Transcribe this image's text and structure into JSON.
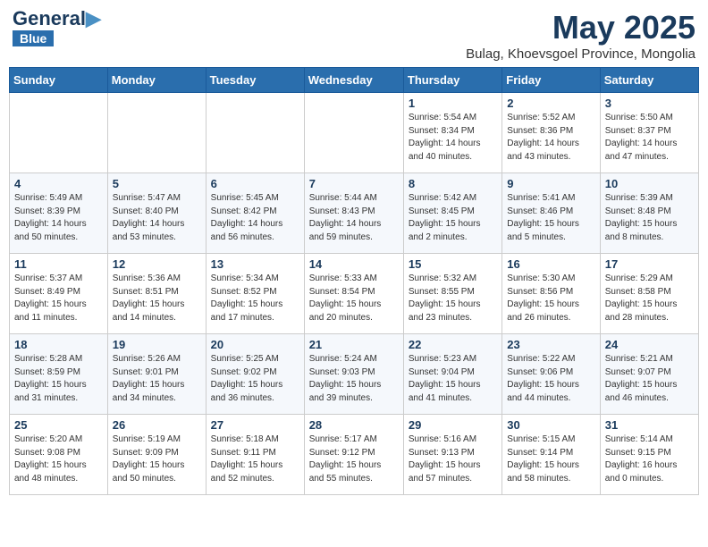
{
  "header": {
    "logo_general": "General",
    "logo_blue": "Blue",
    "month_year": "May 2025",
    "location": "Bulag, Khoevsgoel Province, Mongolia"
  },
  "weekdays": [
    "Sunday",
    "Monday",
    "Tuesday",
    "Wednesday",
    "Thursday",
    "Friday",
    "Saturday"
  ],
  "weeks": [
    [
      {
        "day": "",
        "info": ""
      },
      {
        "day": "",
        "info": ""
      },
      {
        "day": "",
        "info": ""
      },
      {
        "day": "",
        "info": ""
      },
      {
        "day": "1",
        "info": "Sunrise: 5:54 AM\nSunset: 8:34 PM\nDaylight: 14 hours\nand 40 minutes."
      },
      {
        "day": "2",
        "info": "Sunrise: 5:52 AM\nSunset: 8:36 PM\nDaylight: 14 hours\nand 43 minutes."
      },
      {
        "day": "3",
        "info": "Sunrise: 5:50 AM\nSunset: 8:37 PM\nDaylight: 14 hours\nand 47 minutes."
      }
    ],
    [
      {
        "day": "4",
        "info": "Sunrise: 5:49 AM\nSunset: 8:39 PM\nDaylight: 14 hours\nand 50 minutes."
      },
      {
        "day": "5",
        "info": "Sunrise: 5:47 AM\nSunset: 8:40 PM\nDaylight: 14 hours\nand 53 minutes."
      },
      {
        "day": "6",
        "info": "Sunrise: 5:45 AM\nSunset: 8:42 PM\nDaylight: 14 hours\nand 56 minutes."
      },
      {
        "day": "7",
        "info": "Sunrise: 5:44 AM\nSunset: 8:43 PM\nDaylight: 14 hours\nand 59 minutes."
      },
      {
        "day": "8",
        "info": "Sunrise: 5:42 AM\nSunset: 8:45 PM\nDaylight: 15 hours\nand 2 minutes."
      },
      {
        "day": "9",
        "info": "Sunrise: 5:41 AM\nSunset: 8:46 PM\nDaylight: 15 hours\nand 5 minutes."
      },
      {
        "day": "10",
        "info": "Sunrise: 5:39 AM\nSunset: 8:48 PM\nDaylight: 15 hours\nand 8 minutes."
      }
    ],
    [
      {
        "day": "11",
        "info": "Sunrise: 5:37 AM\nSunset: 8:49 PM\nDaylight: 15 hours\nand 11 minutes."
      },
      {
        "day": "12",
        "info": "Sunrise: 5:36 AM\nSunset: 8:51 PM\nDaylight: 15 hours\nand 14 minutes."
      },
      {
        "day": "13",
        "info": "Sunrise: 5:34 AM\nSunset: 8:52 PM\nDaylight: 15 hours\nand 17 minutes."
      },
      {
        "day": "14",
        "info": "Sunrise: 5:33 AM\nSunset: 8:54 PM\nDaylight: 15 hours\nand 20 minutes."
      },
      {
        "day": "15",
        "info": "Sunrise: 5:32 AM\nSunset: 8:55 PM\nDaylight: 15 hours\nand 23 minutes."
      },
      {
        "day": "16",
        "info": "Sunrise: 5:30 AM\nSunset: 8:56 PM\nDaylight: 15 hours\nand 26 minutes."
      },
      {
        "day": "17",
        "info": "Sunrise: 5:29 AM\nSunset: 8:58 PM\nDaylight: 15 hours\nand 28 minutes."
      }
    ],
    [
      {
        "day": "18",
        "info": "Sunrise: 5:28 AM\nSunset: 8:59 PM\nDaylight: 15 hours\nand 31 minutes."
      },
      {
        "day": "19",
        "info": "Sunrise: 5:26 AM\nSunset: 9:01 PM\nDaylight: 15 hours\nand 34 minutes."
      },
      {
        "day": "20",
        "info": "Sunrise: 5:25 AM\nSunset: 9:02 PM\nDaylight: 15 hours\nand 36 minutes."
      },
      {
        "day": "21",
        "info": "Sunrise: 5:24 AM\nSunset: 9:03 PM\nDaylight: 15 hours\nand 39 minutes."
      },
      {
        "day": "22",
        "info": "Sunrise: 5:23 AM\nSunset: 9:04 PM\nDaylight: 15 hours\nand 41 minutes."
      },
      {
        "day": "23",
        "info": "Sunrise: 5:22 AM\nSunset: 9:06 PM\nDaylight: 15 hours\nand 44 minutes."
      },
      {
        "day": "24",
        "info": "Sunrise: 5:21 AM\nSunset: 9:07 PM\nDaylight: 15 hours\nand 46 minutes."
      }
    ],
    [
      {
        "day": "25",
        "info": "Sunrise: 5:20 AM\nSunset: 9:08 PM\nDaylight: 15 hours\nand 48 minutes."
      },
      {
        "day": "26",
        "info": "Sunrise: 5:19 AM\nSunset: 9:09 PM\nDaylight: 15 hours\nand 50 minutes."
      },
      {
        "day": "27",
        "info": "Sunrise: 5:18 AM\nSunset: 9:11 PM\nDaylight: 15 hours\nand 52 minutes."
      },
      {
        "day": "28",
        "info": "Sunrise: 5:17 AM\nSunset: 9:12 PM\nDaylight: 15 hours\nand 55 minutes."
      },
      {
        "day": "29",
        "info": "Sunrise: 5:16 AM\nSunset: 9:13 PM\nDaylight: 15 hours\nand 57 minutes."
      },
      {
        "day": "30",
        "info": "Sunrise: 5:15 AM\nSunset: 9:14 PM\nDaylight: 15 hours\nand 58 minutes."
      },
      {
        "day": "31",
        "info": "Sunrise: 5:14 AM\nSunset: 9:15 PM\nDaylight: 16 hours\nand 0 minutes."
      }
    ]
  ]
}
